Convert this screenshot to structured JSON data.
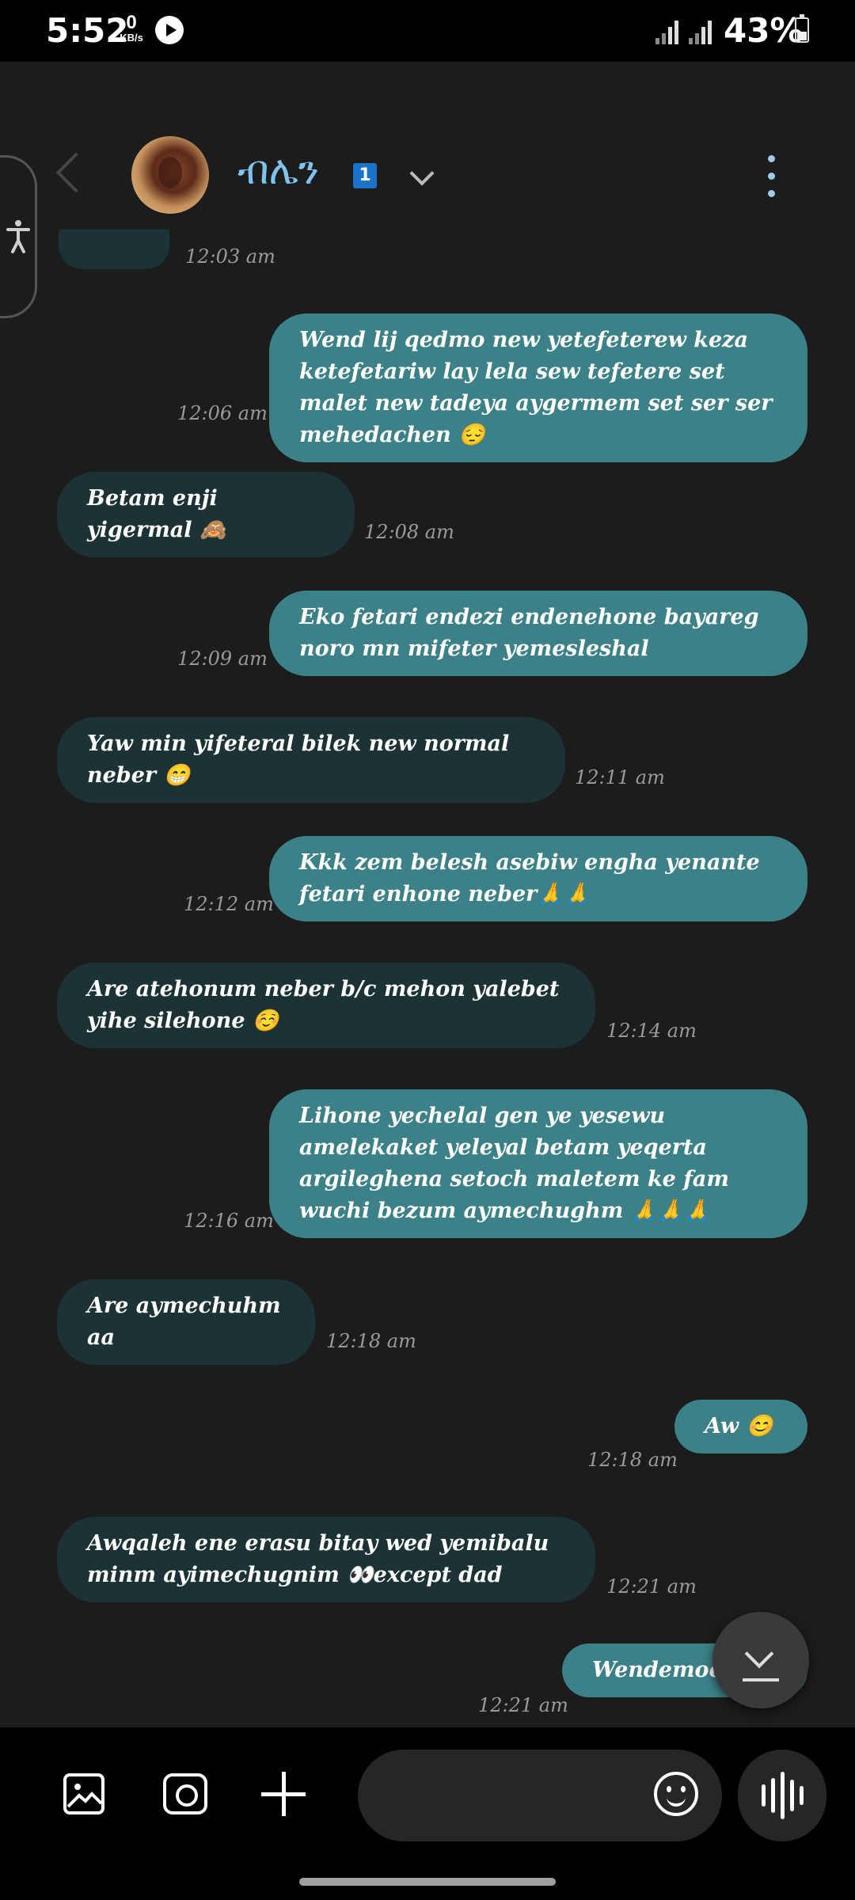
{
  "status_bar": {
    "time": "5:52",
    "net_speed_value": "0",
    "net_speed_unit": "KB/s",
    "battery_percent": "43%"
  },
  "header": {
    "contact_name": "ብሌን",
    "unread_count": "1"
  },
  "messages": [
    {
      "direction": "in",
      "text": "",
      "time": "12:03 am"
    },
    {
      "direction": "out",
      "text": " Wend lij qedmo new yetefeterew keza ketefetariw lay lela sew tefetere set malet new tadeya aygermem set ser ser mehedachen 😔",
      "time": "12:06 am"
    },
    {
      "direction": "in",
      "text": "Betam enji yigermal 🙈",
      "time": "12:08 am"
    },
    {
      "direction": "out",
      "text": "Eko fetari endezi endenehone bayareg noro mn mifeter yemesleshal",
      "time": "12:09 am"
    },
    {
      "direction": "in",
      "text": "Yaw min yifeteral bilek new normal neber 😁",
      "time": "12:11 am"
    },
    {
      "direction": "out",
      "text": "Kkk zem belesh asebiw engha yenante fetari enhone neber🙏🙏",
      "time": "12:12 am"
    },
    {
      "direction": "in",
      "text": "Are atehonum neber b/c mehon yalebet yihe silehone ☺️",
      "time": "12:14 am"
    },
    {
      "direction": "out",
      "text": "Lihone yechelal gen ye yesewu amelekaket yeleyal betam yeqerta argileghena setoch maletem ke fam wuchi bezum aymechughm 🙏🙏🙏",
      "time": "12:16 am"
    },
    {
      "direction": "in",
      "text": "Are aymechuhm aa",
      "time": "12:18 am"
    },
    {
      "direction": "out",
      "text": "Aw 😊",
      "time": "12:18 am"
    },
    {
      "direction": "in",
      "text": "Awqaleh ene erasu bitay wed yemibalu  minm ayimechugnim  👀except dad",
      "time": "12:21 am"
    },
    {
      "direction": "out",
      "text": "Wendemoches",
      "time": "12:21 am"
    }
  ],
  "composer": {
    "placeholder": ""
  },
  "colors": {
    "incoming_bubble": "#1b3334",
    "outgoing_bubble": "#3b8187",
    "contact_name": "#7fc4f0",
    "badge": "#1a73c8"
  }
}
